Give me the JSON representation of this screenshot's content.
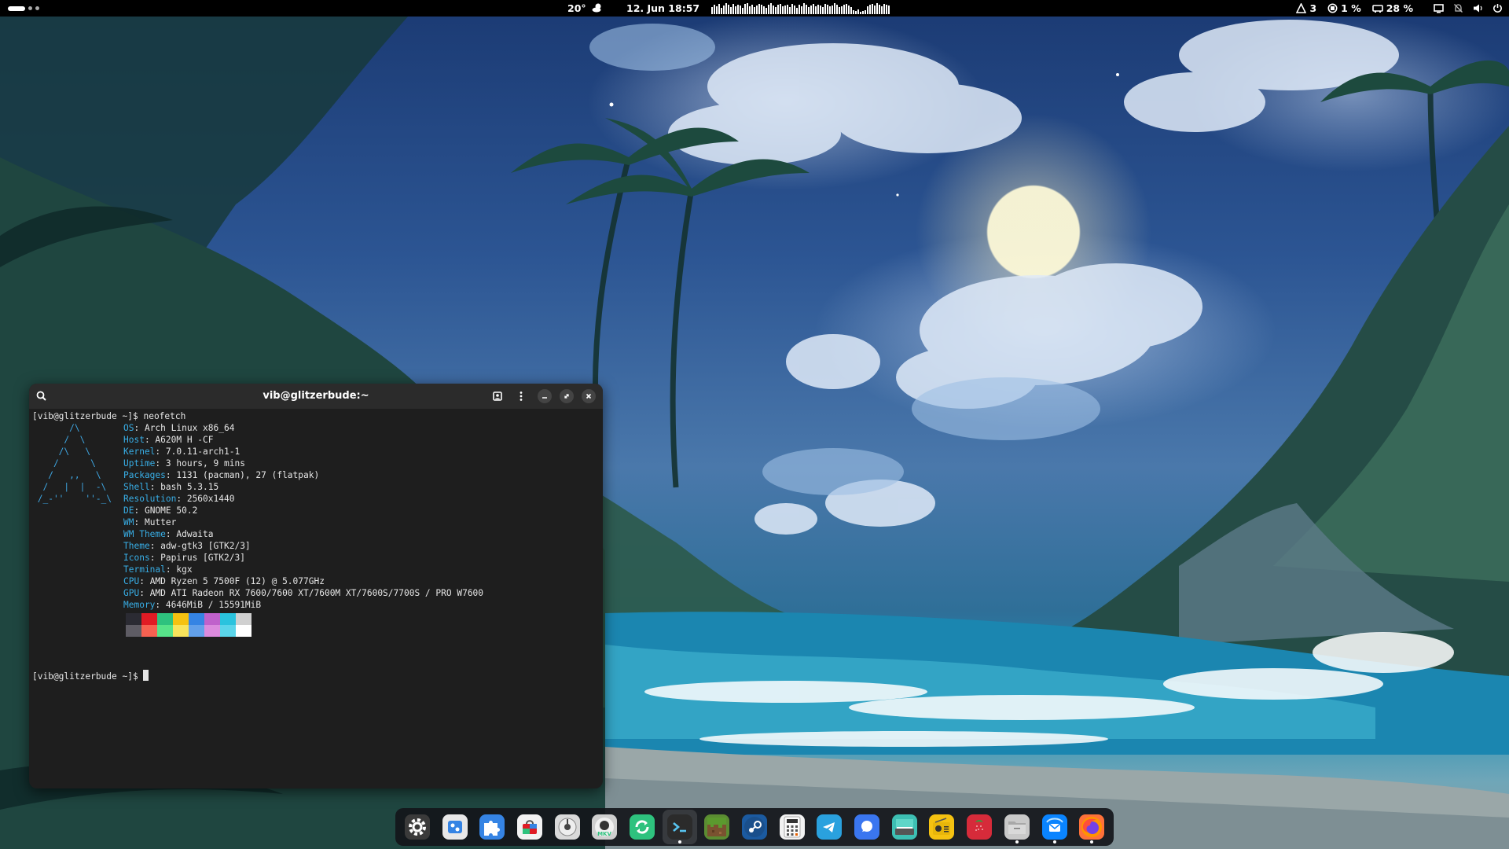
{
  "topbar": {
    "weather_temp": "20°",
    "weather_icon": "cloud-moon-icon",
    "clock": "12. Jun  18:57",
    "tray": {
      "notifications_count": "3",
      "cpu_usage": "1 %",
      "memory_usage": "28 %"
    },
    "status_icons": [
      "monitor-icon",
      "notifications-off-icon",
      "volume-icon",
      "power-icon"
    ]
  },
  "terminal": {
    "title": "vib@glitzerbude:~",
    "header_icons": [
      "search-icon",
      "profile-icon",
      "menu-dots-icon",
      "minimize-icon",
      "maximize-icon",
      "close-icon"
    ],
    "prompt": "[vib@glitzerbude ~]$",
    "command": "neofetch",
    "logo_lines": [
      "       /\\",
      "      /  \\",
      "     /\\   \\",
      "    /      \\",
      "   /   ,,   \\",
      "  /   |  |  -\\",
      " /_-''    ''-_\\"
    ],
    "info": [
      {
        "key": "OS",
        "value": "Arch Linux x86_64"
      },
      {
        "key": "Host",
        "value": "A620M H -CF"
      },
      {
        "key": "Kernel",
        "value": "7.0.11-arch1-1"
      },
      {
        "key": "Uptime",
        "value": "3 hours, 9 mins"
      },
      {
        "key": "Packages",
        "value": "1131 (pacman), 27 (flatpak)"
      },
      {
        "key": "Shell",
        "value": "bash 5.3.15"
      },
      {
        "key": "Resolution",
        "value": "2560x1440"
      },
      {
        "key": "DE",
        "value": "GNOME 50.2"
      },
      {
        "key": "WM",
        "value": "Mutter"
      },
      {
        "key": "WM Theme",
        "value": "Adwaita"
      },
      {
        "key": "Theme",
        "value": "adw-gtk3 [GTK2/3]"
      },
      {
        "key": "Icons",
        "value": "Papirus [GTK2/3]"
      },
      {
        "key": "Terminal",
        "value": "kgx"
      },
      {
        "key": "CPU",
        "value": "AMD Ryzen 5 7500F (12) @ 5.077GHz"
      },
      {
        "key": "GPU",
        "value": "AMD ATI Radeon RX 7600/7600 XT/7600M XT/7600S/7700S / PRO W7600"
      },
      {
        "key": "Memory",
        "value": "4646MiB / 15591MiB"
      }
    ],
    "palette_top": [
      "#2b2b33",
      "#e01b24",
      "#2ec27e",
      "#f5c211",
      "#3584e4",
      "#c061cb",
      "#2ac3de",
      "#d0d0d0"
    ],
    "palette_bottom": [
      "#5e5c64",
      "#f66151",
      "#57e389",
      "#f8e45c",
      "#62a0ea",
      "#dc8add",
      "#5bd5ea",
      "#ffffff"
    ],
    "final_prompt": "[vib@glitzerbude ~]$"
  },
  "dock": {
    "apps": [
      {
        "name": "settings",
        "icon": "gear-icon",
        "color": "#3a3a3a",
        "running": false
      },
      {
        "name": "tweaks",
        "icon": "tweaks-icon",
        "color": "#e8e8e8",
        "running": false
      },
      {
        "name": "extensions",
        "icon": "puzzle-piece-icon",
        "color": "#3584e4",
        "running": false
      },
      {
        "name": "software",
        "icon": "shopping-bag-icon",
        "color": "#f2f2f2",
        "running": false
      },
      {
        "name": "disks",
        "icon": "disk-icon",
        "color": "#d9d9d9",
        "running": false
      },
      {
        "name": "mkv-player",
        "icon": "mkv-icon",
        "color": "#cfcfcf",
        "running": false
      },
      {
        "name": "sync",
        "icon": "sync-arrows-icon",
        "color": "#2ec27e",
        "running": false
      },
      {
        "name": "terminal",
        "icon": "terminal-prompt-icon",
        "color": "#2b2b2b",
        "running": true
      },
      {
        "name": "minecraft",
        "icon": "grass-block-icon",
        "color": "#5b8c32",
        "running": false
      },
      {
        "name": "steam",
        "icon": "steam-icon",
        "color": "#1b5aa0",
        "running": false
      },
      {
        "name": "calculator",
        "icon": "calculator-icon",
        "color": "#f2f2f2",
        "running": false
      },
      {
        "name": "telegram",
        "icon": "paper-plane-icon",
        "color": "#2aa1de",
        "running": false
      },
      {
        "name": "signal",
        "icon": "chat-bubble-icon",
        "color": "#3a76f0",
        "running": false
      },
      {
        "name": "scanner",
        "icon": "scanner-icon",
        "color": "#3dbfb3",
        "running": false
      },
      {
        "name": "radio",
        "icon": "radio-icon",
        "color": "#f5c211",
        "running": false
      },
      {
        "name": "raspberry-imager",
        "icon": "strawberry-icon",
        "color": "#d62b3a",
        "running": false
      },
      {
        "name": "files",
        "icon": "folder-icon",
        "color": "#c9c9c9",
        "running": true
      },
      {
        "name": "thunderbird",
        "icon": "mail-bird-icon",
        "color": "#0a84ff",
        "running": true
      },
      {
        "name": "firefox",
        "icon": "firefox-icon",
        "color": "#ff7139",
        "running": true
      }
    ]
  }
}
